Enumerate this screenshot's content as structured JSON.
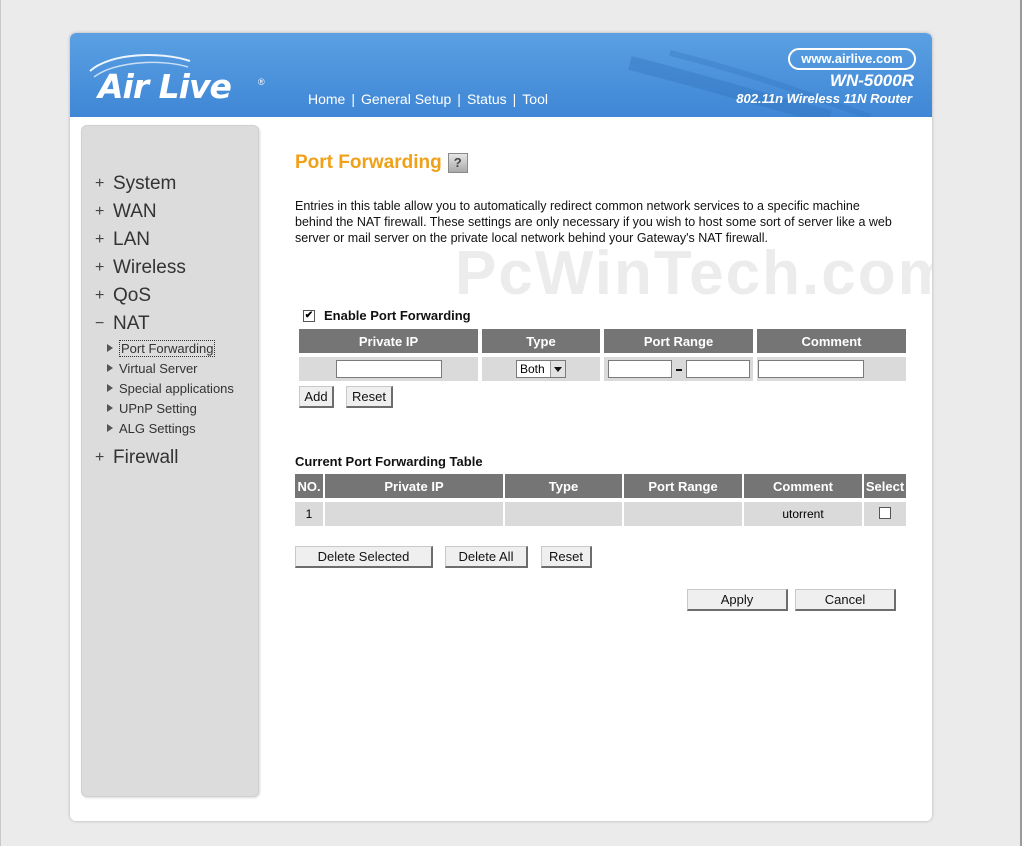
{
  "brand": {
    "logo_text": "Air Live",
    "registered": "®",
    "url": "www.airlive.com",
    "model": "WN-5000R",
    "model_desc": "802.11n Wireless 11N Router",
    "header_color": "#4590dc"
  },
  "nav": {
    "items": [
      "Home",
      "General Setup",
      "Status",
      "Tool"
    ],
    "separator": "|"
  },
  "sidebar": {
    "items": [
      {
        "sign": "+",
        "label": "System"
      },
      {
        "sign": "+",
        "label": "WAN"
      },
      {
        "sign": "+",
        "label": "LAN"
      },
      {
        "sign": "+",
        "label": "Wireless"
      },
      {
        "sign": "+",
        "label": "QoS"
      },
      {
        "sign": "−",
        "label": "NAT"
      }
    ],
    "subitems": [
      "Port Forwarding",
      "Virtual Server",
      "Special applications",
      "UPnP Setting",
      "ALG Settings"
    ],
    "active_subitem": "Port Forwarding",
    "last_item": {
      "sign": "+",
      "label": "Firewall"
    }
  },
  "page": {
    "title": "Port Forwarding",
    "help_icon": "?",
    "description": "Entries in this table allow you to automatically redirect common network services to a specific machine behind the NAT firewall. These settings are only necessary if you wish to host some sort of server like a web server or mail server on the private local network behind your Gateway's NAT firewall.",
    "watermark": "PcWinTech.com",
    "accent_color": "#f0a019"
  },
  "entry_form": {
    "enable_label": "Enable Port Forwarding",
    "enable_checked": true,
    "check_mark": "✔",
    "headers": [
      "Private IP",
      "Type",
      "Port Range",
      "Comment"
    ],
    "private_ip": "",
    "type_selected": "Both",
    "port_from": "",
    "port_to": "",
    "comment": "",
    "add_label": "Add",
    "reset_label": "Reset"
  },
  "current_table": {
    "title": "Current Port Forwarding Table",
    "headers": [
      "NO.",
      "Private IP",
      "Type",
      "Port Range",
      "Comment",
      "Select"
    ],
    "rows": [
      {
        "no": "1",
        "private_ip": "",
        "type": "",
        "port_range": "",
        "comment": "utorrent",
        "selected": false
      }
    ],
    "delete_selected_label": "Delete Selected",
    "delete_all_label": "Delete All",
    "reset_label": "Reset"
  },
  "actions": {
    "apply_label": "Apply",
    "cancel_label": "Cancel"
  }
}
